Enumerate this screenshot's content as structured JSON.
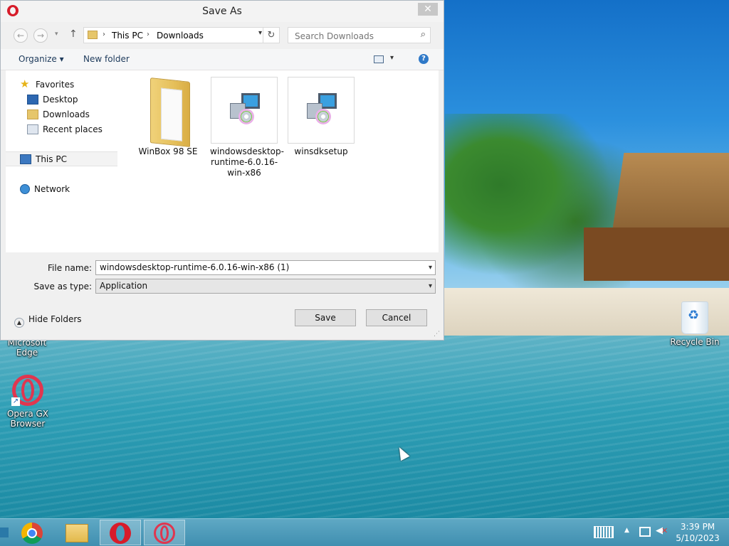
{
  "dialog": {
    "title": "Save As",
    "close_label": "✕",
    "address": {
      "crumb1": "This PC",
      "crumb2": "Downloads"
    },
    "search": {
      "placeholder": "Search Downloads"
    },
    "toolbar": {
      "organize": "Organize ▾",
      "new_folder": "New folder",
      "help": "?"
    },
    "navpane": {
      "favorites": "Favorites",
      "desktop": "Desktop",
      "downloads": "Downloads",
      "recent": "Recent places",
      "this_pc": "This PC",
      "network": "Network"
    },
    "files": [
      {
        "name": "WinBox 98 SE",
        "icon": "folder-icon"
      },
      {
        "name": "windowsdesktop-runtime-6.0.16-win-x86",
        "icon": "installer-icon"
      },
      {
        "name": "winsdksetup",
        "icon": "installer-icon"
      }
    ],
    "file_name_label": "File name:",
    "file_name_value": "windowsdesktop-runtime-6.0.16-win-x86 (1)",
    "save_type_label": "Save as type:",
    "save_type_value": "Application",
    "hide_folders": "Hide Folders",
    "save_button": "Save",
    "cancel_button": "Cancel"
  },
  "desktop": {
    "icons": {
      "edge": "Microsoft Edge",
      "opera_gx": "Opera GX Browser",
      "recycle": "Recycle Bin"
    }
  },
  "taskbar": {
    "items": [
      "chrome-icon",
      "file-explorer-icon",
      "opera-icon",
      "opera-gx-icon"
    ],
    "clock": {
      "time": "3:39 PM",
      "date": "5/10/2023"
    }
  },
  "colors": {
    "accent": "#d71c2a",
    "taskbar": "#4f9cbb"
  }
}
